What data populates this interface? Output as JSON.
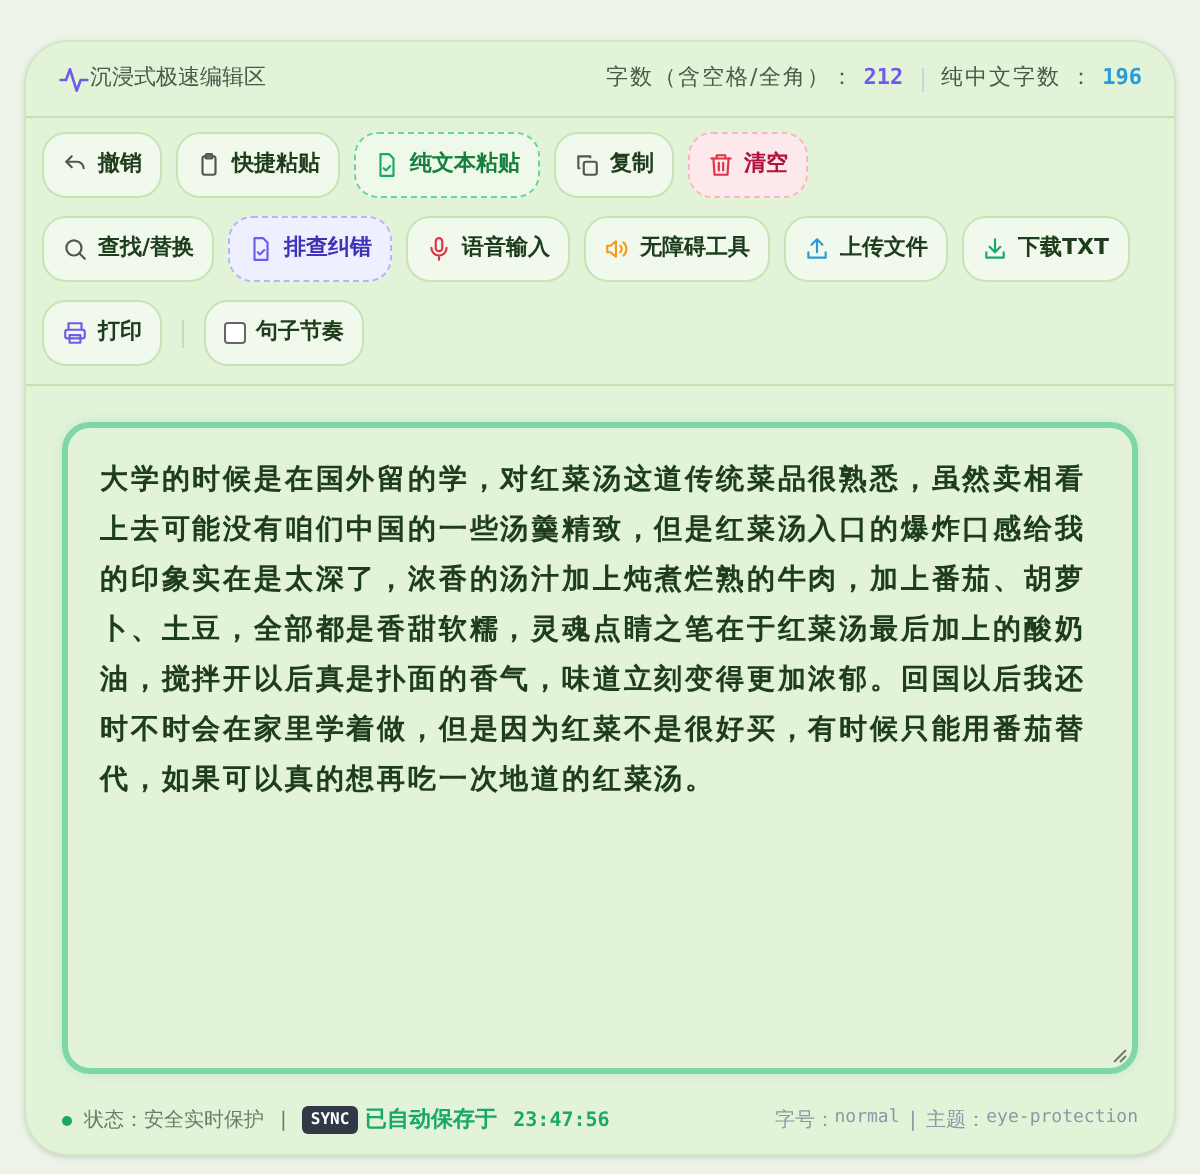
{
  "header": {
    "title": "沉浸式极速编辑区",
    "stats": [
      {
        "label": "字数（含空格/全角）：",
        "value": "212",
        "color": "#6d5ce8"
      },
      {
        "label": "纯中文字数 ：",
        "value": "196",
        "color": "#2b9bd6"
      }
    ]
  },
  "toolbar": [
    [
      {
        "label": "撤销",
        "kind": "plain"
      },
      {
        "label": "快捷粘贴",
        "kind": "plain"
      },
      {
        "label": "纯文本粘贴",
        "kind": "accent"
      },
      {
        "label": "复制",
        "kind": "plain"
      },
      {
        "label": "清空",
        "kind": "danger"
      }
    ],
    [
      {
        "label": "查找/替换",
        "kind": "plain"
      },
      {
        "label": "排查纠错",
        "kind": "highlight"
      },
      {
        "label": "语音输入",
        "kind": "plain"
      },
      {
        "label": "无障碍工具",
        "kind": "plain"
      },
      {
        "label": "上传文件",
        "kind": "plain"
      },
      {
        "label": "下载TXT",
        "kind": "plain"
      }
    ],
    [
      {
        "label": "打印",
        "kind": "plain"
      },
      {
        "label": "句子节奏",
        "kind": "checkbox",
        "checked": false
      }
    ]
  ],
  "editor": {
    "value": "大学的时候是在国外留的学，对红菜汤这道传统菜品很熟悉，虽然卖相看上去可能没有咱们中国的一些汤羹精致，但是红菜汤入口的爆炸口感给我的印象实在是太深了，浓香的汤汁加上炖煮烂熟的牛肉，加上番茄、胡萝卜、土豆，全部都是香甜软糯，灵魂点睛之笔在于红菜汤最后加上的酸奶油，搅拌开以后真是扑面的香气，味道立刻变得更加浓郁。回国以后我还时不时会在家里学着做，但是因为红菜不是很好买，有时候只能用番茄替代，如果可以真的想再吃一次地道的红菜汤。"
  },
  "status_bar": {
    "status": "状态：安全实时保护",
    "separator": "|",
    "badge": "SYNC",
    "saved_label": "已自动保存于",
    "saved_time": "23:47:56",
    "font_label": "字号：",
    "font_value": "normal",
    "separator_2": "|",
    "theme_label": "主题：",
    "theme_value": "eye-protection"
  }
}
